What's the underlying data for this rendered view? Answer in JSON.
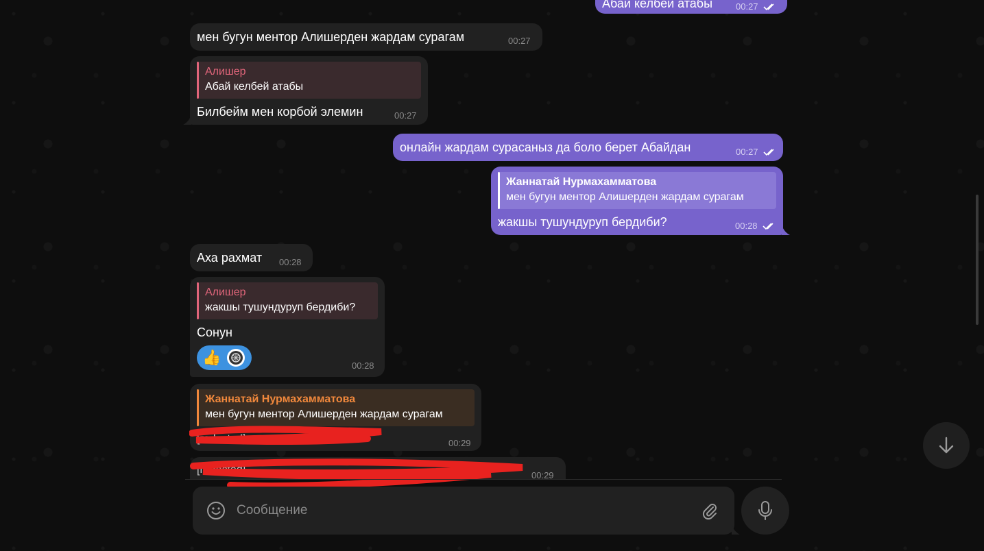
{
  "chat": {
    "messages": [
      {
        "id": "m0",
        "text": "Абай келбей атабы",
        "time": "00:27",
        "direction": "out"
      },
      {
        "id": "m1",
        "text": "мен бугун ментор Алишерден жардам сурагам",
        "time": "00:27",
        "direction": "in"
      },
      {
        "id": "m2",
        "reply_author": "Алишер",
        "reply_text": "Абай келбей атабы",
        "text": "Билбейм мен корбой элемин",
        "time": "00:27",
        "direction": "in"
      },
      {
        "id": "m3",
        "text": "онлайн жардам сурасаныз да боло берет Абайдан",
        "time": "00:27",
        "direction": "out"
      },
      {
        "id": "m4",
        "reply_author": "Жаннатай Нурмахамматова",
        "reply_text": "мен бугун ментор Алишерден жардам сурагам",
        "text": "жакшы тушундуруп бердиби?",
        "time": "00:28",
        "direction": "out"
      },
      {
        "id": "m5",
        "text": "Аха рахмат",
        "time": "00:28",
        "direction": "in"
      },
      {
        "id": "m6",
        "reply_author": "Алишер",
        "reply_text": "жакшы тушундуруп бердиби?",
        "text": "Сонун",
        "time": "00:28",
        "direction": "in",
        "reactions": [
          "thumbs-up",
          "sticker-avatar"
        ]
      },
      {
        "id": "m7",
        "reply_author": "Жаннатай Нурмахамматова",
        "reply_text": "мен бугун ментор Алишерден жардам сурагам",
        "text": "[redacted]",
        "time": "00:29",
        "direction": "in"
      },
      {
        "id": "m8",
        "text": "[redacted]",
        "time": "00:29",
        "direction": "in"
      }
    ]
  },
  "composer": {
    "placeholder": "Сообщение",
    "icons": [
      "emoji-icon",
      "attach-icon",
      "mic-icon"
    ]
  },
  "colors": {
    "incoming_bubble": "#212121",
    "outgoing_bubble": "#7763cc",
    "reply_author_alisher": "#e0657a",
    "reply_author_zhannatai_out": "#ffffff",
    "reply_author_zhannatai_in": "#f0883c",
    "reaction_pill": "#3d92e0",
    "redaction": "#e8221f"
  }
}
